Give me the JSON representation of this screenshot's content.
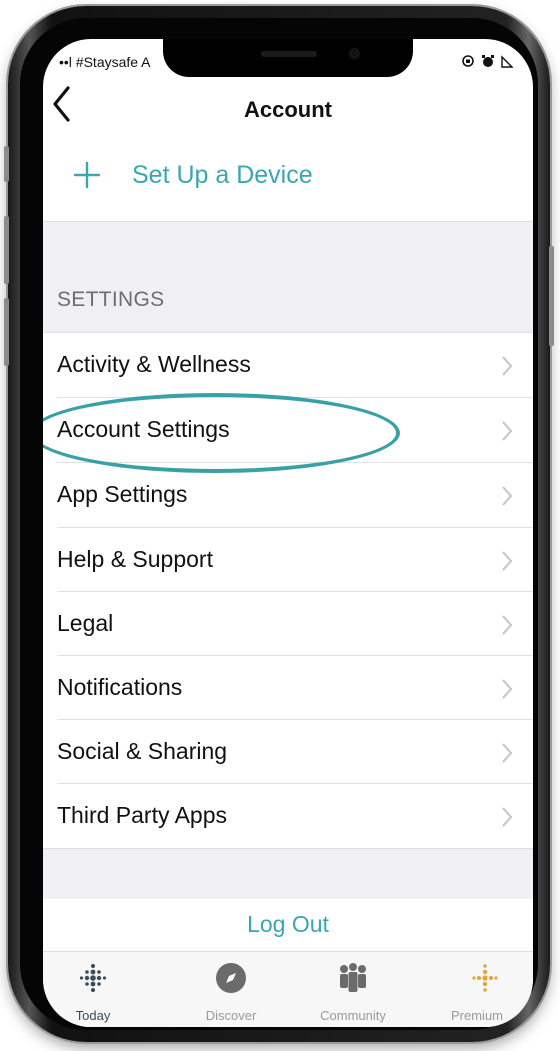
{
  "status_bar": {
    "carrier_text": "••l #Staysafe A",
    "right_icons": [
      "lock-rotation-icon",
      "alarm-icon",
      "battery-icon"
    ]
  },
  "nav": {
    "title": "Account",
    "back_icon": "chevron-left-icon"
  },
  "setup_device": {
    "label": "Set Up a Device",
    "icon": "plus-icon"
  },
  "settings": {
    "header": "SETTINGS",
    "items": [
      {
        "label": "Activity & Wellness"
      },
      {
        "label": "Account Settings"
      },
      {
        "label": "App Settings"
      },
      {
        "label": "Help & Support"
      },
      {
        "label": "Legal"
      },
      {
        "label": "Notifications"
      },
      {
        "label": "Social & Sharing"
      },
      {
        "label": "Third Party Apps"
      }
    ]
  },
  "logout": {
    "label": "Log Out"
  },
  "tabbar": {
    "tabs": [
      {
        "label": "Today",
        "icon": "fitbit-dots-icon"
      },
      {
        "label": "Discover",
        "icon": "compass-icon"
      },
      {
        "label": "Community",
        "icon": "community-icon"
      },
      {
        "label": "Premium",
        "icon": "premium-dots-icon"
      }
    ]
  },
  "colors": {
    "accent": "#39a7b0",
    "premium": "#e0a63a",
    "highlight": "#3aa0a8"
  }
}
